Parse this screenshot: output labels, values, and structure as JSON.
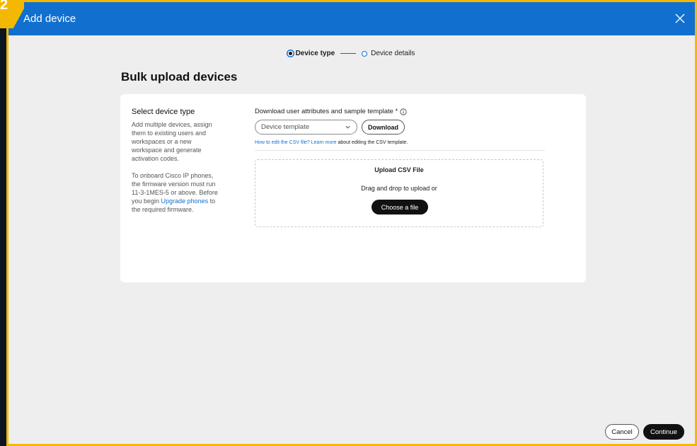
{
  "corner_badge": "2",
  "window": {
    "title": "Add device"
  },
  "stepper": {
    "steps": [
      {
        "label": "Device type",
        "state": "active"
      },
      {
        "label": "Device details",
        "state": "inactive"
      }
    ]
  },
  "page": {
    "title": "Bulk upload devices"
  },
  "sidebar": {
    "title": "Select device type",
    "paragraph1": "Add multiple devices, assign them to existing users and workspaces or a new workspace and generate activation codes.",
    "paragraph2_prefix": "To onboard Cisco IP phones, the firmware version must run 11-3-1MES-5 or above. Before you begin ",
    "paragraph2_link": "Upgrade phones",
    "paragraph2_suffix": " to the required firmware."
  },
  "download": {
    "label": "Download user attributes and sample template *",
    "select_value": "Device template",
    "button_label": "Download",
    "help_link": "How to edit the CSV file? Learn more",
    "help_suffix": " about editing the CSV template."
  },
  "upload": {
    "title": "Upload CSV File",
    "text": "Drag and drop to upload or",
    "button_label": "Choose a file"
  },
  "footer": {
    "cancel_label": "Cancel",
    "continue_label": "Continue"
  },
  "colors": {
    "accent": "#1170cf",
    "highlight": "#f5b800"
  }
}
